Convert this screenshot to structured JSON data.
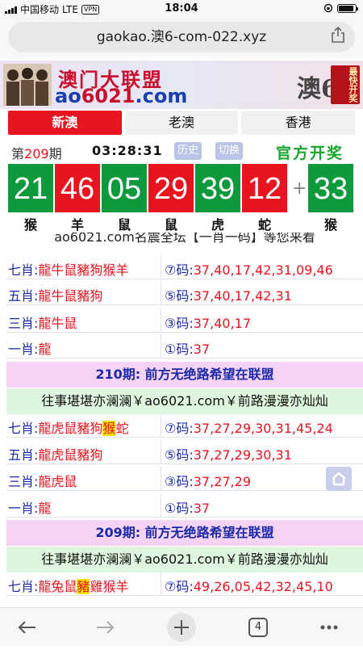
{
  "status_bar": {
    "carrier": "中国移动",
    "network": "LTE",
    "vpn": "VPN",
    "time": "18:04",
    "battery_level": 0.9
  },
  "browser": {
    "url": "gaokao.澳6-com-022.xyz",
    "tab_count": "4"
  },
  "banner": {
    "title": "澳门大联盟",
    "site_prefix": "ao",
    "site_number": "6021",
    "site_suffix": ".com",
    "logo_char": "澳6",
    "stamp_text": "最快开奖"
  },
  "tabs": [
    {
      "label": "新澳",
      "active": true
    },
    {
      "label": "老澳",
      "active": false
    },
    {
      "label": "香港",
      "active": false
    }
  ],
  "draw": {
    "period_prefix": "第",
    "period_number": "209",
    "period_suffix": "期",
    "countdown": "03:28:31",
    "history_label": "历史",
    "switch_label": "切换",
    "official_label": "官方开奖"
  },
  "balls": [
    {
      "number": "21",
      "zodiac": "猴",
      "color": "green"
    },
    {
      "number": "46",
      "zodiac": "羊",
      "color": "red"
    },
    {
      "number": "05",
      "zodiac": "鼠",
      "color": "green"
    },
    {
      "number": "29",
      "zodiac": "鼠",
      "color": "red"
    },
    {
      "number": "39",
      "zodiac": "虎",
      "color": "green"
    },
    {
      "number": "12",
      "zodiac": "蛇",
      "color": "red"
    }
  ],
  "special_ball": {
    "number": "33",
    "zodiac": "猴",
    "color": "green"
  },
  "plus_sign": "+",
  "content": {
    "cut_title": "ao6021.com名震全坛【一肖一码】等您来看",
    "group1": [
      {
        "label": "七肖:",
        "animals": "龍牛鼠豬狗猴羊",
        "code_label": "⑦码:",
        "codes": "37,40,17,42,31,09,46"
      },
      {
        "label": "五肖:",
        "animals": "龍牛鼠豬狗",
        "code_label": "⑤码:",
        "codes": "37,40,17,42,31"
      },
      {
        "label": "三肖:",
        "animals": "龍牛鼠",
        "code_label": "③码:",
        "codes": "37,40,17"
      },
      {
        "label": "一肖:",
        "animals": "龍",
        "code_label": "①码:",
        "codes": "37"
      }
    ],
    "period_210_head": "210期: 前方无绝路希望在联盟",
    "motto": "往事堪堪亦澜澜￥ao6021.com￥前路漫漫亦灿灿",
    "group2": [
      {
        "label": "七肖:",
        "animals_a": "龍虎鼠豬狗",
        "animals_hl": "猴",
        "animals_b": "蛇",
        "code_label": "⑦码:",
        "codes": "37,27,29,30,31,45,24"
      },
      {
        "label": "五肖:",
        "animals": "龍虎鼠豬狗",
        "code_label": "⑤码:",
        "codes": "37,27,29,30,31"
      },
      {
        "label": "三肖:",
        "animals": "龍虎鼠",
        "code_label": "③码:",
        "codes": "37,27,29"
      },
      {
        "label": "一肖:",
        "animals": "龍",
        "code_label": "①码:",
        "codes": "37"
      }
    ],
    "period_209_head": "209期: 前方无绝路希望在联盟",
    "motto2": "往事堪堪亦澜澜￥ao6021.com￥前路漫漫亦灿灿",
    "group3": [
      {
        "label": "七肖:",
        "animals_a": "龍兔鼠",
        "animals_hl": "豬",
        "animals_b": "雞猴羊",
        "code_label": "⑦码:",
        "codes": "49,26,05,42,32,45,10"
      }
    ]
  }
}
